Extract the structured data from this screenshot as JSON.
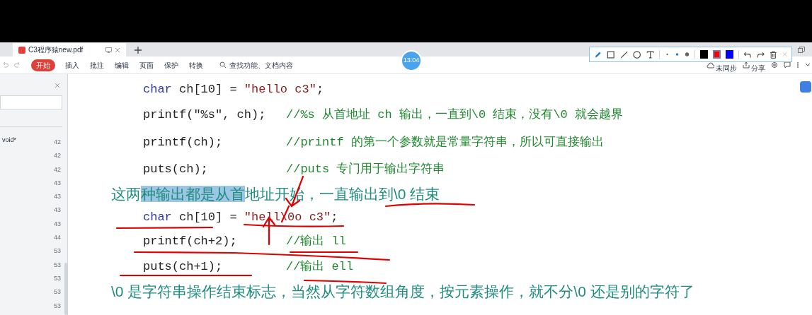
{
  "tab": {
    "title": "C3程序猿new.pdf"
  },
  "ribbon_tabs": [
    {
      "label": "开始",
      "selected": true
    },
    {
      "label": "插入",
      "selected": false
    },
    {
      "label": "批注",
      "selected": false
    },
    {
      "label": "编辑",
      "selected": false
    },
    {
      "label": "页面",
      "selected": false
    },
    {
      "label": "保护",
      "selected": false
    },
    {
      "label": "转换",
      "selected": false
    }
  ],
  "search": {
    "placeholder": "查找功能、文档内容"
  },
  "clock": "13:04",
  "sync_status": "未同步",
  "share": "分享",
  "draw_tools": [
    {
      "kind": "pen",
      "selected": true
    },
    {
      "kind": "rect",
      "selected": false
    },
    {
      "kind": "line",
      "selected": false
    },
    {
      "kind": "ellipse",
      "selected": false
    },
    {
      "kind": "text",
      "selected": false
    }
  ],
  "pen_sizes": [
    {
      "kind": "small",
      "selected": false
    },
    {
      "kind": "medium",
      "selected": true
    },
    {
      "kind": "large",
      "selected": false
    }
  ],
  "pen_colors": [
    {
      "color": "#000000",
      "selected": false
    },
    {
      "color": "#ff0000",
      "selected": true
    },
    {
      "color": "#0000ff",
      "selected": false
    }
  ],
  "sidebar": {
    "entry": "void*",
    "line_numbers": [
      "42",
      "42",
      "42",
      "43",
      "43",
      "43",
      "43",
      "44",
      "53",
      "53",
      "53",
      "53",
      "53"
    ]
  },
  "document": {
    "lines": [
      {
        "kind": "code",
        "segments": [
          {
            "kind": "keyword",
            "text": "char"
          },
          {
            "kind": "plain",
            "text": " ch[10] = "
          },
          {
            "kind": "string",
            "text": "″hello c3″"
          },
          {
            "kind": "plain",
            "text": ";"
          }
        ]
      },
      {
        "kind": "code",
        "segments": [
          {
            "kind": "plain",
            "text": "printf(″%s″, ch);"
          }
        ],
        "comment": "//%s 从首地址 ch 输出，一直到\\0 结束，没有\\0 就会越界"
      },
      {
        "kind": "code",
        "segments": [
          {
            "kind": "plain",
            "text": "printf(ch);"
          }
        ],
        "comment": "//printf 的第一个参数就是常量字符串，所以可直接输出"
      },
      {
        "kind": "code",
        "segments": [
          {
            "kind": "plain",
            "text": "puts(ch);"
          }
        ],
        "comment": "//puts 专门用于输出字符串"
      },
      {
        "kind": "prose",
        "segments": [
          {
            "text": "这两",
            "highlighted": false
          },
          {
            "text": "种输出都是从首",
            "highlighted": true
          },
          {
            "text": "地址开始，一直输出到\\0 结束",
            "highlighted": false
          }
        ]
      },
      {
        "kind": "code",
        "segments": [
          {
            "kind": "keyword",
            "text": "char"
          },
          {
            "kind": "plain",
            "text": " ch[10] = "
          },
          {
            "kind": "string",
            "text": "″hell\\0o c3″"
          },
          {
            "kind": "plain",
            "text": ";"
          }
        ]
      },
      {
        "kind": "code",
        "segments": [
          {
            "kind": "plain",
            "text": "printf(ch+2);"
          }
        ],
        "comment": "//输出 ll"
      },
      {
        "kind": "code",
        "segments": [
          {
            "kind": "plain",
            "text": "puts(ch+1);"
          }
        ],
        "comment": "//输出 ell"
      },
      {
        "kind": "prose",
        "segments": [
          {
            "text": "\\0 是字符串操作结束标志，当然从字符数组角度，按元素操作，就不分\\0 还是别的字符了",
            "highlighted": false
          }
        ]
      }
    ]
  }
}
